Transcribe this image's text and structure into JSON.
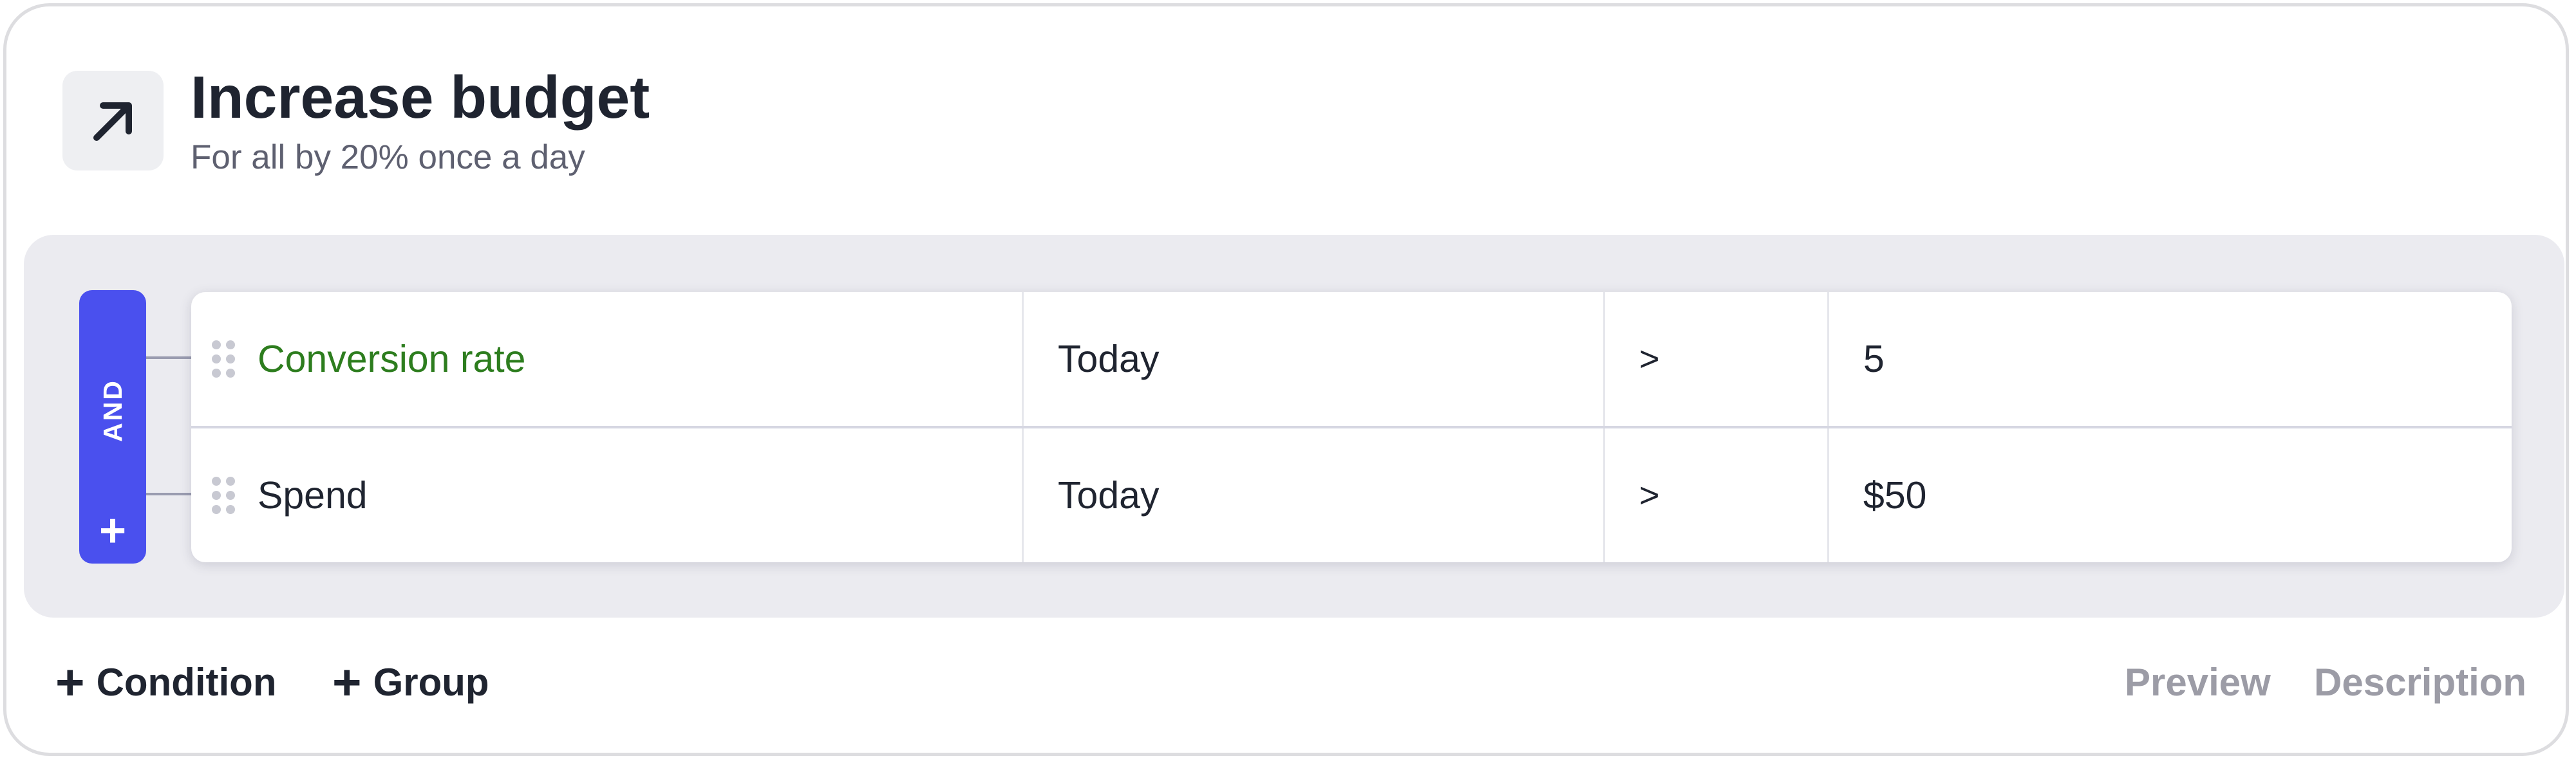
{
  "header": {
    "icon": "arrow-up-right-icon",
    "title": "Increase budget",
    "subtitle": "For all by 20% once a day"
  },
  "group": {
    "operator_label": "AND",
    "add_symbol": "+",
    "rows": [
      {
        "metric": "Conversion rate",
        "period": "Today",
        "operator": ">",
        "value": "5",
        "metric_color": "#2d7d1e"
      },
      {
        "metric": "Spend",
        "period": "Today",
        "operator": ">",
        "value": "$50",
        "metric_color": "#1f2430"
      }
    ]
  },
  "footer": {
    "add_condition": {
      "symbol": "+",
      "label": "Condition"
    },
    "add_group": {
      "symbol": "+",
      "label": "Group"
    },
    "preview_label": "Preview",
    "description_label": "Description"
  },
  "colors": {
    "accent": "#4a50ee",
    "highlight_metric": "#2d7d1e",
    "muted_link": "#9c9ca6",
    "panel_background": "#ebebf0"
  }
}
